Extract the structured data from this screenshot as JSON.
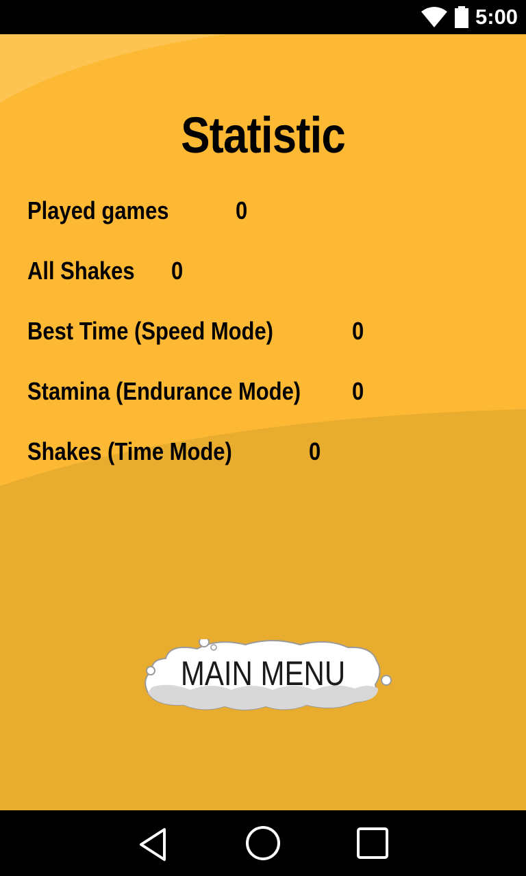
{
  "status_bar": {
    "time": "5:00",
    "icons": [
      "wifi-icon",
      "battery-icon"
    ]
  },
  "colors": {
    "background_light": "#FDB933",
    "background_dark": "#E8AC2F",
    "text": "#000000",
    "cloud_fill": "#FFFFFF",
    "cloud_shadow": "#D8D8D8",
    "system_bar": "#000000"
  },
  "screen": {
    "title": "Statistic",
    "stats": [
      {
        "label": "Played games",
        "value": "0"
      },
      {
        "label": "All Shakes",
        "value": "0"
      },
      {
        "label": "Best Time (Speed Mode)",
        "value": "0"
      },
      {
        "label": "Stamina (Endurance Mode)",
        "value": "0"
      },
      {
        "label": "Shakes (Time Mode)",
        "value": "0"
      }
    ],
    "main_menu_label": "MAIN MENU"
  },
  "nav_bar": {
    "icons": [
      "back-icon",
      "home-icon",
      "recents-icon"
    ]
  }
}
